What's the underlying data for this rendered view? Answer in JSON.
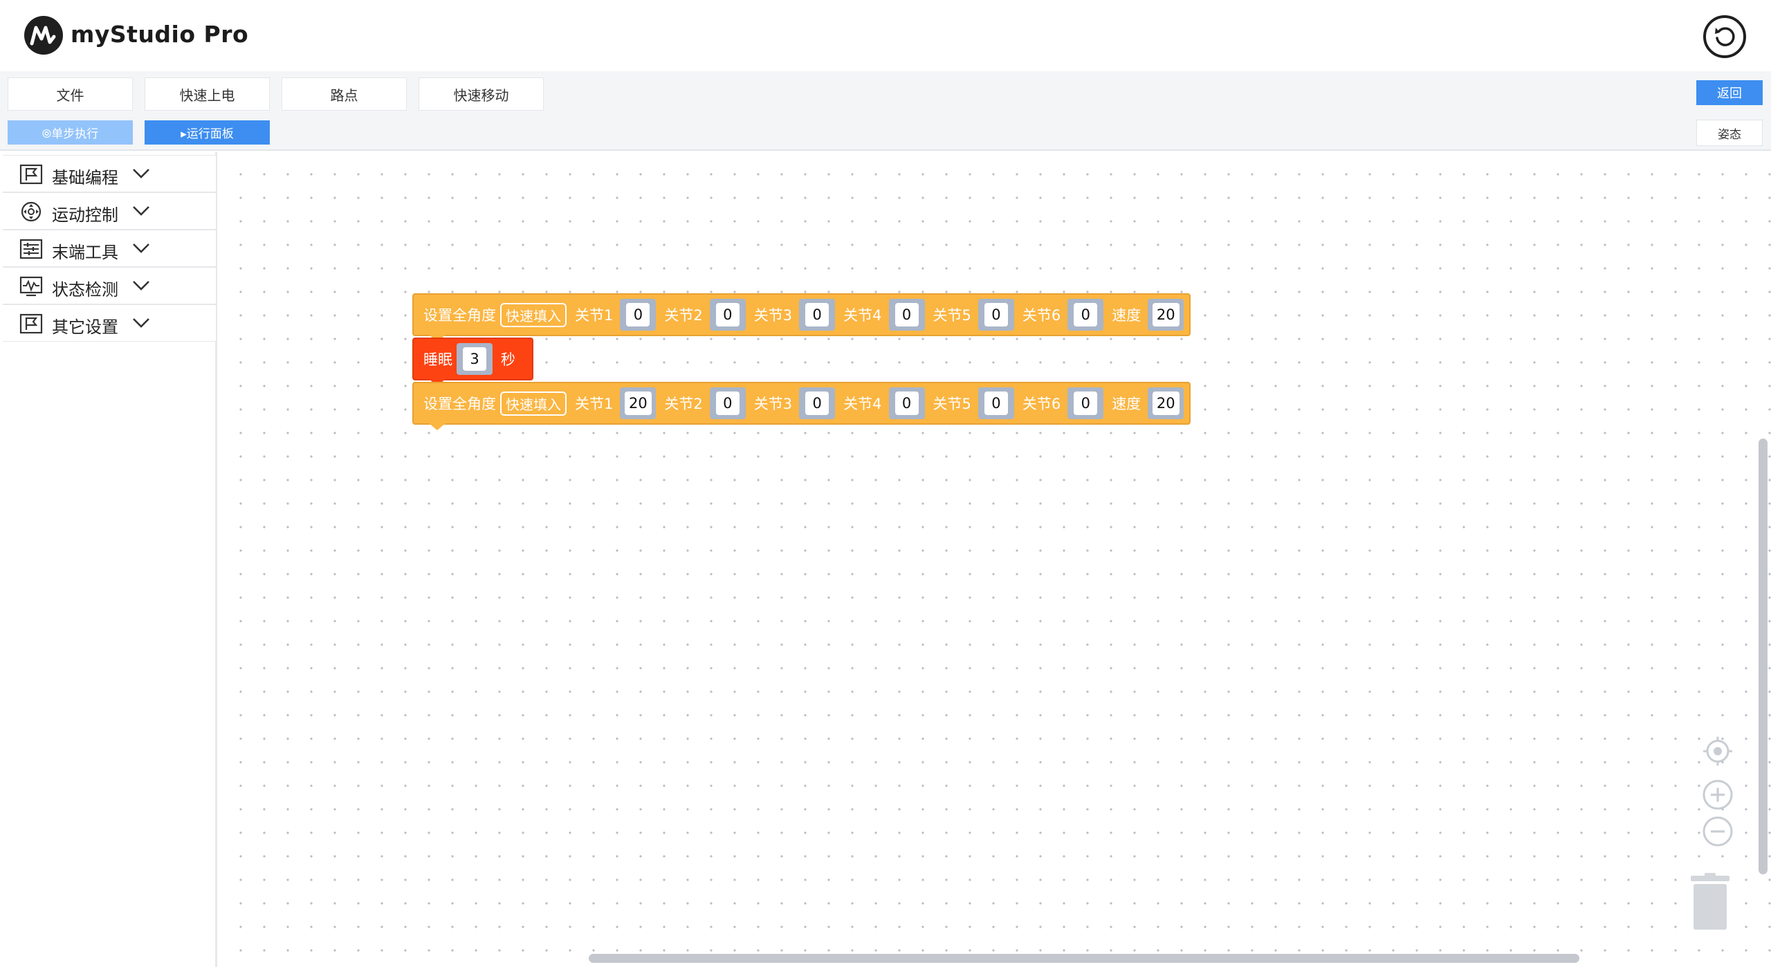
{
  "header": {
    "app_title": "myStudio Pro",
    "logo_icon": "mystudio-logo",
    "undo_icon": "undo-icon"
  },
  "toolbar": {
    "menu": [
      "文件",
      "快速上电",
      "路点",
      "快速移动"
    ],
    "step_label": "⦾单步执行",
    "run_panel_label": "▸运行面板",
    "return_label": "返回",
    "pose_label": "姿态"
  },
  "sidebar": {
    "items": [
      {
        "label": "基础编程",
        "icon": "flag-icon"
      },
      {
        "label": "运动控制",
        "icon": "motion-icon"
      },
      {
        "label": "末端工具",
        "icon": "tool-icon"
      },
      {
        "label": "状态检测",
        "icon": "monitor-icon"
      },
      {
        "label": "其它设置",
        "icon": "flag-icon"
      }
    ]
  },
  "blocks": [
    {
      "type": "set_joints",
      "label": "设置全角度",
      "quick_fill": "快速填入",
      "joints": [
        {
          "label": "关节1",
          "value": "0"
        },
        {
          "label": "关节2",
          "value": "0"
        },
        {
          "label": "关节3",
          "value": "0"
        },
        {
          "label": "关节4",
          "value": "0"
        },
        {
          "label": "关节5",
          "value": "0"
        },
        {
          "label": "关节6",
          "value": "0"
        },
        {
          "label": "速度",
          "value": "20"
        }
      ]
    },
    {
      "type": "sleep",
      "label": "睡眠",
      "value": "3",
      "unit": "秒"
    },
    {
      "type": "set_joints",
      "label": "设置全角度",
      "quick_fill": "快速填入",
      "joints": [
        {
          "label": "关节1",
          "value": "20"
        },
        {
          "label": "关节2",
          "value": "0"
        },
        {
          "label": "关节3",
          "value": "0"
        },
        {
          "label": "关节4",
          "value": "0"
        },
        {
          "label": "关节5",
          "value": "0"
        },
        {
          "label": "关节6",
          "value": "0"
        },
        {
          "label": "速度",
          "value": "20"
        }
      ]
    }
  ],
  "canvas_controls": {
    "center_icon": "target-icon",
    "zoom_in_icon": "zoom-in-icon",
    "zoom_out_icon": "zoom-out-icon",
    "trash_icon": "trash-icon"
  },
  "colors": {
    "accent": "#3d8ef0",
    "accent_light": "#92c3fb",
    "block_orange": "#fbb541",
    "block_red": "#fe4312",
    "slot": "#a9b5c9"
  }
}
